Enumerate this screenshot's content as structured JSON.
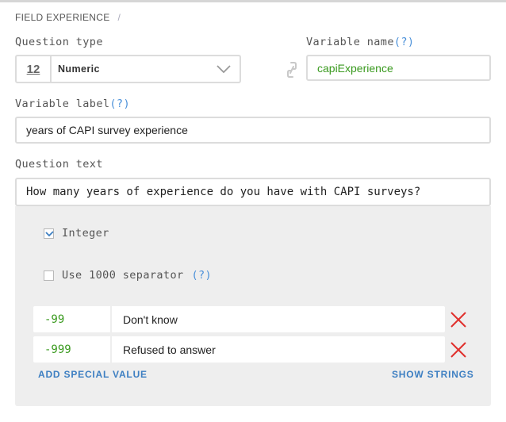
{
  "section": {
    "title": "FIELD EXPERIENCE",
    "separator": "/"
  },
  "question_type": {
    "label": "Question type",
    "icon_text": "12",
    "value": "Numeric",
    "icon": "chevron-down-icon"
  },
  "variable_name": {
    "label": "Variable name",
    "help": "(?)",
    "value": "capiExperience",
    "link_icon": "link-icon"
  },
  "variable_label": {
    "label": "Variable label",
    "help": "(?)",
    "value": "years of CAPI survey experience"
  },
  "question_text": {
    "label": "Question text",
    "value": "How many years of experience do you have with CAPI surveys?"
  },
  "options": {
    "integer": {
      "label": "Integer",
      "checked": true
    },
    "separator": {
      "label": "Use 1000 separator",
      "help": "(?)",
      "checked": false
    }
  },
  "special_values": [
    {
      "code": "-99",
      "text": "Don't know"
    },
    {
      "code": "-999",
      "text": "Refused to answer"
    }
  ],
  "actions": {
    "add_special_value": "ADD SPECIAL VALUE",
    "show_strings": "SHOW STRINGS"
  },
  "colors": {
    "value_green": "#3a9a1f",
    "link_blue": "#3d7fc2",
    "delete_red": "#e0302c",
    "help_blue": "#4a90d9"
  }
}
